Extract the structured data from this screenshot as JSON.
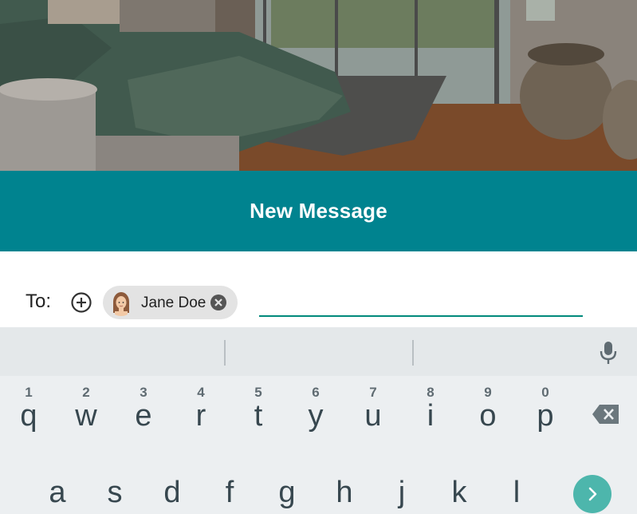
{
  "header": {
    "title": "New Message"
  },
  "compose": {
    "to_label": "To:",
    "add_icon": "plus-circle-icon",
    "recipients": [
      {
        "name": "Jane Doe",
        "remove_icon": "close-circle-icon"
      }
    ],
    "input_value": "",
    "accent": "#00897b"
  },
  "colors": {
    "title_bar": "#00838f",
    "keyboard_bg": "#eceff1",
    "enter_key": "#4db6ac"
  },
  "keyboard": {
    "suggestions": [
      "",
      "",
      ""
    ],
    "mic_icon": "microphone-icon",
    "row1": [
      {
        "ch": "q",
        "hint": "1"
      },
      {
        "ch": "w",
        "hint": "2"
      },
      {
        "ch": "e",
        "hint": "3"
      },
      {
        "ch": "r",
        "hint": "4"
      },
      {
        "ch": "t",
        "hint": "5"
      },
      {
        "ch": "y",
        "hint": "6"
      },
      {
        "ch": "u",
        "hint": "7"
      },
      {
        "ch": "i",
        "hint": "8"
      },
      {
        "ch": "o",
        "hint": "9"
      },
      {
        "ch": "p",
        "hint": "0"
      }
    ],
    "backspace_icon": "backspace-icon",
    "row2": [
      "a",
      "s",
      "d",
      "f",
      "g",
      "h",
      "j",
      "k",
      "l"
    ],
    "enter_icon": "chevron-right-icon"
  }
}
